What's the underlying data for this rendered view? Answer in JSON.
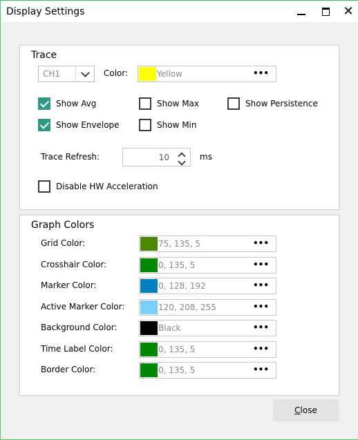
{
  "window": {
    "title": "Display Settings",
    "controls": {
      "minimize": "minimize",
      "maximize": "maximize",
      "close": "close"
    }
  },
  "trace": {
    "group_title": "Trace",
    "channel": {
      "selected": "CH1"
    },
    "color_label": "Color:",
    "color": {
      "swatch": "#ffff00",
      "value": "Yellow",
      "more": "•••"
    },
    "checkboxes": {
      "show_avg": {
        "label": "Show Avg",
        "checked": true
      },
      "show_max": {
        "label": "Show Max",
        "checked": false
      },
      "show_persistence": {
        "label": "Show Persistence",
        "checked": false
      },
      "show_envelope": {
        "label": "Show Envelope",
        "checked": true
      },
      "show_min": {
        "label": "Show Min",
        "checked": false
      }
    },
    "refresh_label": "Trace Refresh:",
    "refresh_value": "10",
    "refresh_unit": "ms",
    "hw_accel": {
      "label": "Disable HW Acceleration",
      "checked": false
    }
  },
  "graph_colors": {
    "group_title": "Graph Colors",
    "rows": [
      {
        "label": "Grid Color:",
        "swatch": "#4b8705",
        "value": "75, 135, 5",
        "more": "•••"
      },
      {
        "label": "Crosshair Color:",
        "swatch": "#008705",
        "value": "0, 135, 5",
        "more": "•••"
      },
      {
        "label": "Marker Color:",
        "swatch": "#0080c0",
        "value": "0, 128, 192",
        "more": "•••"
      },
      {
        "label": "Active Marker Color:",
        "swatch": "#78d0ff",
        "value": "120, 208, 255",
        "more": "•••"
      },
      {
        "label": "Background Color:",
        "swatch": "#000000",
        "value": "Black",
        "more": "•••"
      },
      {
        "label": "Time Label Color:",
        "swatch": "#008705",
        "value": "0, 135, 5",
        "more": "•••"
      },
      {
        "label": "Border Color:",
        "swatch": "#008705",
        "value": "0, 135, 5",
        "more": "•••"
      }
    ]
  },
  "footer": {
    "close_button": {
      "first_letter": "C",
      "rest": "lose"
    }
  },
  "theme": {
    "check_accent": "#2e9a85",
    "window_border": "#50c878"
  }
}
